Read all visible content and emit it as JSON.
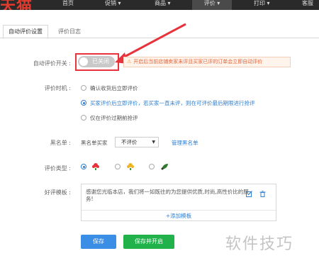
{
  "nav": {
    "logo": "天猫",
    "items": [
      "首页",
      "促销 ▾",
      "商品 ▾",
      "评价 ▾",
      "打印 ▾",
      "客服"
    ]
  },
  "tabs": {
    "active": "自动评价设置",
    "other": "评价日志"
  },
  "auto_review": {
    "label": "自动评价开关 :",
    "toggle_text": "已关闭",
    "warning": "开启后当前店铺卖家未评且买家已评的订单会立即自动评价"
  },
  "timing": {
    "label": "评价时机 :",
    "options": [
      "确认收货后立即评价",
      "买家评价后立即评价，若买家一直未评，则在可评价最后期限进行抢评",
      "仅在评价过期前抢评"
    ]
  },
  "blacklist": {
    "label": "黑名单 :",
    "prefix": "黑名单买家",
    "select": "不评价",
    "manage_link": "管理黑名单"
  },
  "review_type": {
    "label": "评价类型 :"
  },
  "template": {
    "label": "好评模板 :",
    "text": "感谢您光临本店，我们将一如既往的为您提供优质,时尚,高性价比的服务!",
    "add_label": "+添加模板"
  },
  "buttons": {
    "save": "保存",
    "save_open": "保存并开启"
  },
  "watermark": "软件技巧",
  "colors": {
    "accent": "#2f7fd1",
    "highlight": "#e8323c",
    "success": "#21b24c",
    "warning": "#e2643a"
  }
}
